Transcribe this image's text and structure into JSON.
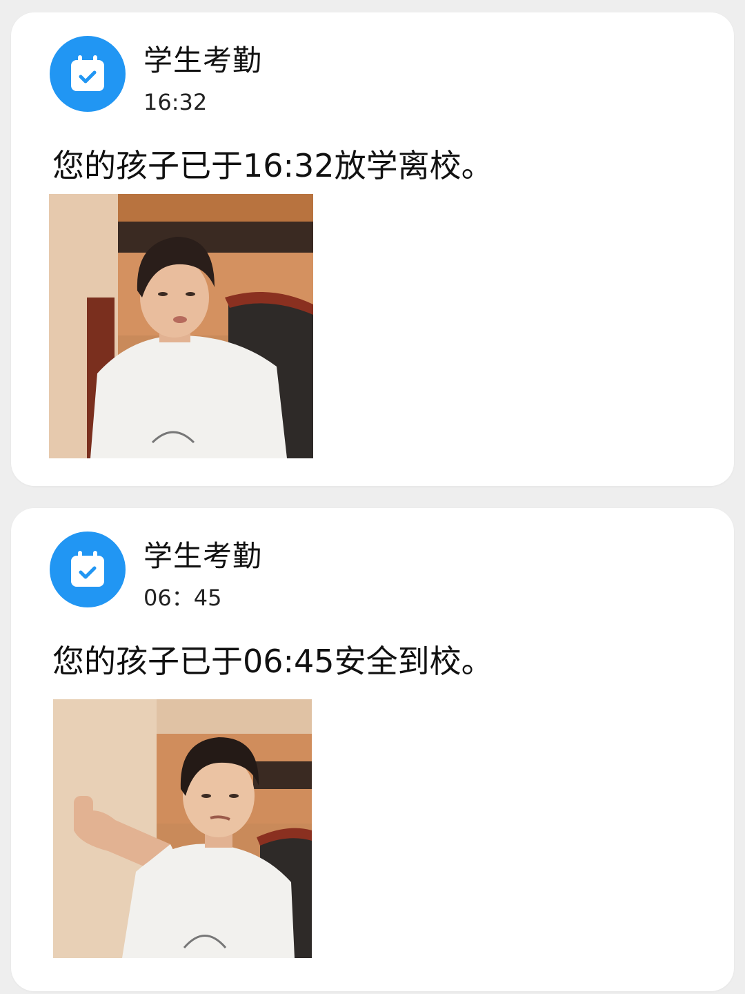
{
  "notifications": [
    {
      "app_name": "学生考勤",
      "time": "16:32",
      "message": "您的孩子已于16:32放学离校。",
      "icon": "calendar-check-icon",
      "image": "photo-boy-talking"
    },
    {
      "app_name": "学生考勤",
      "time": "06：45",
      "message": "您的孩子已于06:45安全到校。",
      "icon": "calendar-check-icon",
      "image": "photo-boy-pointing"
    }
  ],
  "colors": {
    "icon_background": "#2196f3",
    "card_background": "#ffffff",
    "page_background": "#eeeeee"
  }
}
